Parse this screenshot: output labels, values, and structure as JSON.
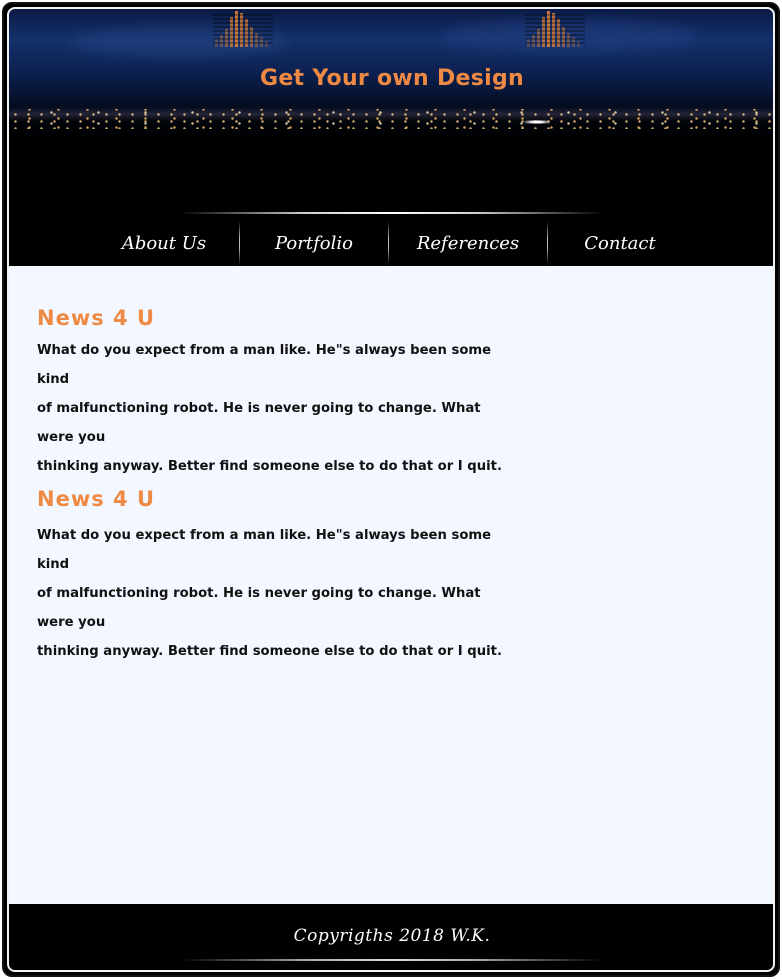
{
  "header": {
    "site_title": "Get Your own Design",
    "logo_icon": "equalizer-bars-icon"
  },
  "nav": {
    "items": [
      {
        "label": "About Us"
      },
      {
        "label": "Portfolio"
      },
      {
        "label": "References"
      },
      {
        "label": "Contact"
      }
    ]
  },
  "main": {
    "news": [
      {
        "title": "News  4  U",
        "lines": [
          "What do you expect from a man like. He\"s always been some kind",
          "of malfunctioning robot. He is never going to change. What were you",
          "thinking anyway. Better find someone else to do that or I quit."
        ]
      },
      {
        "title": "News  4  U",
        "lines": [
          "What do you expect from a man like. He\"s always been some kind",
          "of malfunctioning robot. He is never going to change. What were you",
          "thinking anyway. Better find someone else to do that or I quit."
        ]
      }
    ]
  },
  "footer": {
    "copyright": "Copyrigths  2018  W.K."
  },
  "colors": {
    "accent": "#ef8a45",
    "content_bg": "#f3f7ff",
    "frame": "#000000"
  }
}
